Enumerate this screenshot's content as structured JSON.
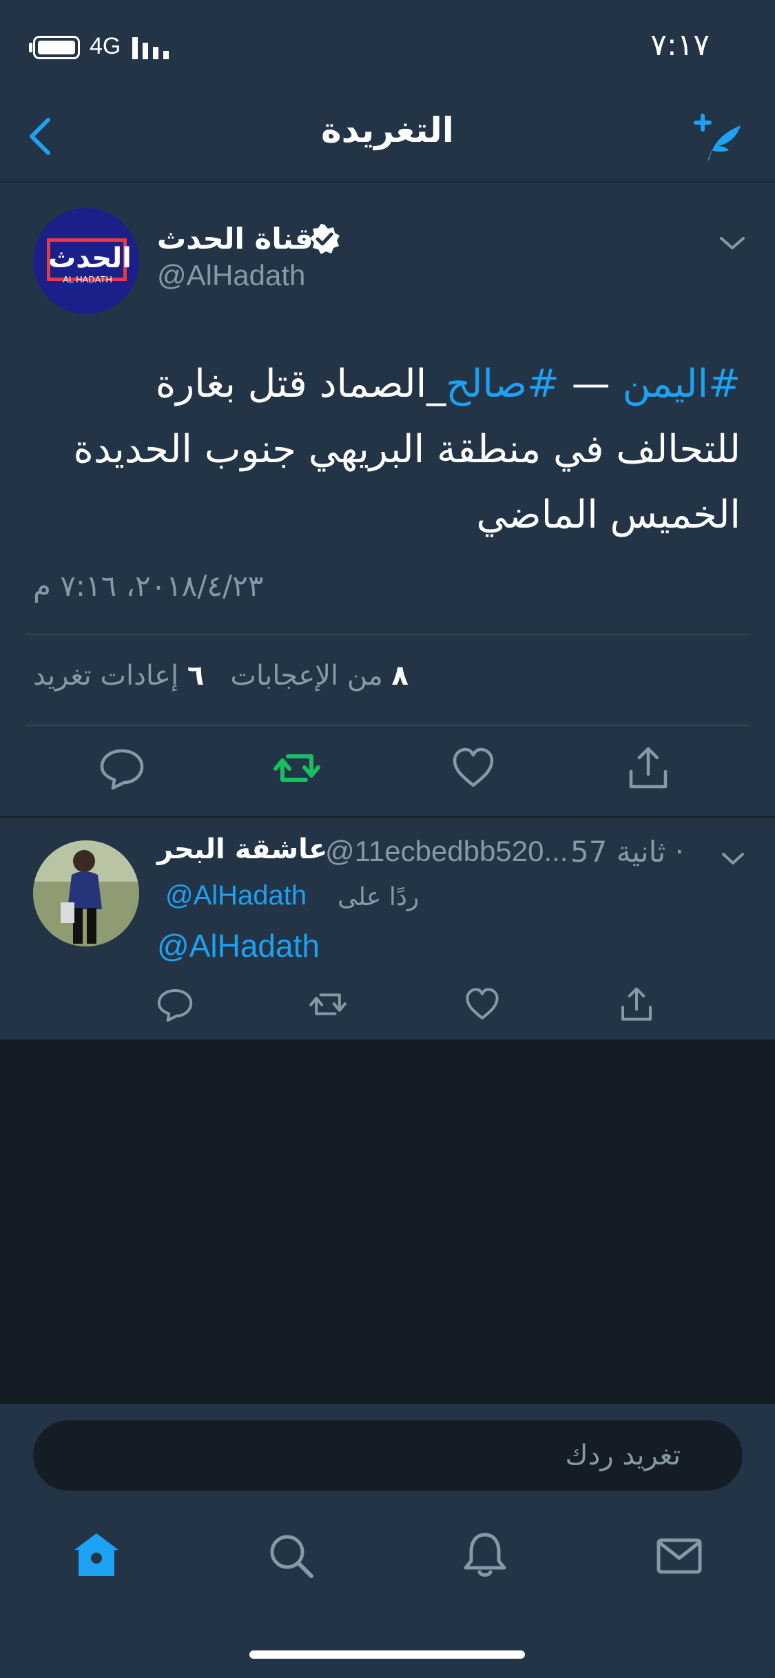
{
  "status_bar": {
    "network": "4G",
    "time": "٧:١٧"
  },
  "nav": {
    "title": "التغريدة"
  },
  "tweet": {
    "author_name": "قناة الحدث",
    "author_handle": "@AlHadath",
    "avatar_logo": "الحدث",
    "avatar_logo_sub": "AL HADATH",
    "hashtag1": "#اليمن",
    "dash": " — ",
    "hashtag2": "#صالح",
    "text_rest": "_الصماد قتل بغارة للتحالف في منطقة البريهي جنوب الحديدة الخميس الماضي",
    "timestamp": "٢٠١٨/٤/٢٣، ٧:١٦ م",
    "retweets_count": "٦",
    "retweets_label": "إعادات تغريد",
    "likes_count": "٨",
    "likes_label": "من الإعجابات"
  },
  "reply": {
    "author_name": "عاشقة البحر",
    "author_handle": "@11ecbedbb520...",
    "meta": "57 ثانية ·",
    "reply_to_label": "ردًا على",
    "reply_to_handle": "@AlHadath",
    "text": "@AlHadath"
  },
  "composer": {
    "placeholder": "تغريد ردك"
  },
  "colors": {
    "accent": "#1da1f2",
    "retweet_active": "#17bf63",
    "background": "#141d26",
    "card": "#243447"
  }
}
